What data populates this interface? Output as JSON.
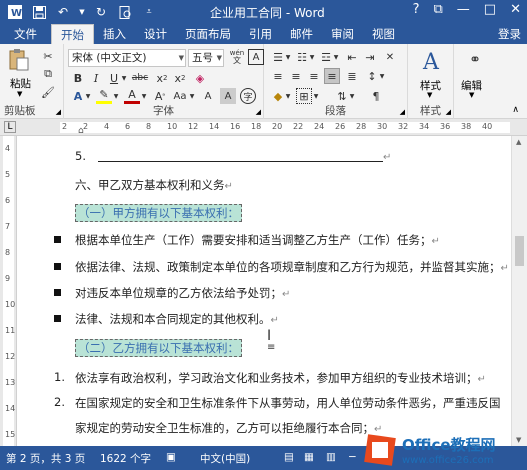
{
  "title_bar": {
    "title": "企业用工合同 - Word",
    "help": "?",
    "restore": "⧉",
    "minimize": "—",
    "maximize": "□",
    "close": "✕"
  },
  "tabs": {
    "file": "文件",
    "items": [
      "开始",
      "插入",
      "设计",
      "页面布局",
      "引用",
      "邮件",
      "审阅",
      "视图"
    ],
    "signin": "登录"
  },
  "ribbon": {
    "clipboard": {
      "paste": "粘贴",
      "label": "剪贴板"
    },
    "font": {
      "name": "宋体 (中文正文)",
      "size": "五号",
      "label": "字体",
      "wen": "wén"
    },
    "paragraph": {
      "label": "段落"
    },
    "styles": {
      "name": "样式",
      "label": "样式"
    },
    "editing": {
      "name": "编辑"
    }
  },
  "ruler": {
    "h_numbers": [
      "2",
      "2",
      "4",
      "6",
      "8",
      "10",
      "12",
      "14",
      "16",
      "18",
      "20",
      "22",
      "24",
      "26",
      "28",
      "30",
      "32",
      "34",
      "36",
      "38",
      "40"
    ],
    "v_numbers": [
      "4",
      "5",
      "6",
      "7",
      "8",
      "9",
      "10",
      "11",
      "12",
      "13",
      "14",
      "15"
    ]
  },
  "document": {
    "line5": "5.",
    "heading6": "六、甲乙双方基本权利和义务",
    "h1": "（一）甲方拥有以下基本权利：",
    "b1": "根据本单位生产（工作）需要安排和适当调整乙方生产（工作）任务；",
    "b2": "依据法律、法规、政策制定本单位的各项规章制度和乙方行为规范，并监督其实施；",
    "b3": "对违反本单位规章的乙方依法给予处罚；",
    "b4": "法律、法规和本合同规定的其他权利。",
    "h2": "（二）乙方拥有以下基本权利：",
    "n1_num": "1.",
    "n1": "依法享有政治权利，学习政治文化和业务技术，参加甲方组织的专业技术培训；",
    "n2_num": "2.",
    "n2a": "在国家规定的安全和卫生标准条件下从事劳动，用人单位劳动条件恶劣，严重违反国",
    "n2b": "家规定的劳动安全卫生标准的，乙方可以拒绝履行本合同；",
    "para_mark": "↵"
  },
  "status": {
    "page": "第 2 页，共 3 页",
    "words": "1622 个字",
    "lang": "中文(中国)",
    "zoom_minus": "−",
    "zoom_plus": "+"
  },
  "watermark": {
    "brand": "Office教程网",
    "url": "www.office26.com"
  }
}
